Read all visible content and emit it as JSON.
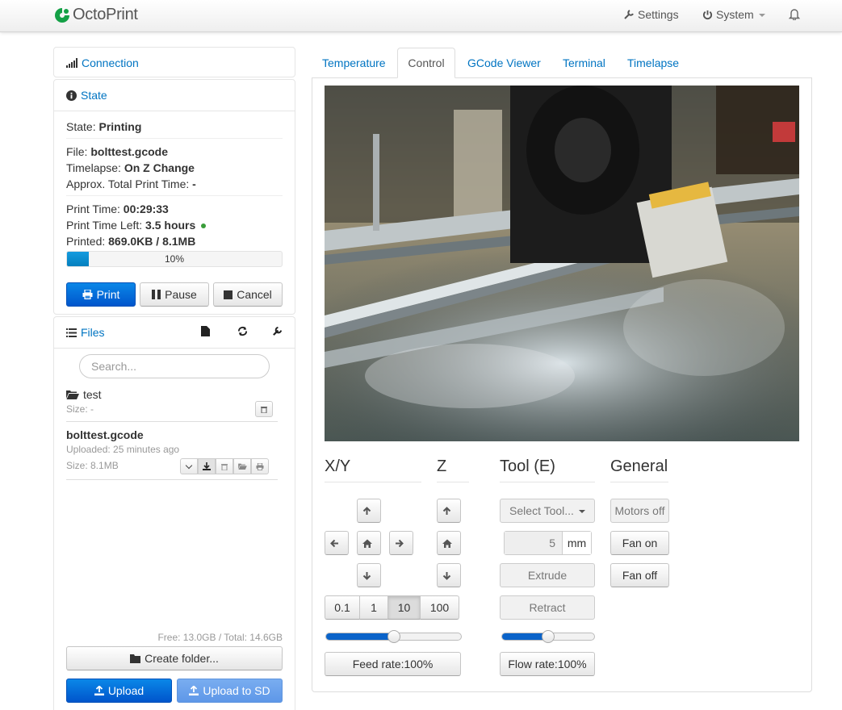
{
  "app": {
    "brand": "OctoPrint"
  },
  "navbar": {
    "settings": "Settings",
    "system": "System"
  },
  "sidebar": {
    "connection": {
      "title": "Connection"
    },
    "state": {
      "title": "State",
      "state_label": "State:",
      "state_value": "Printing",
      "file_label": "File:",
      "file_value": "bolttest.gcode",
      "timelapse_label": "Timelapse:",
      "timelapse_value": "On Z Change",
      "approx_label": "Approx. Total Print Time:",
      "approx_value": "-",
      "print_time_label": "Print Time:",
      "print_time_value": "00:29:33",
      "time_left_label": "Print Time Left:",
      "time_left_value": "3.5 hours",
      "printed_label": "Printed:",
      "printed_value": "869.0KB / 8.1MB",
      "progress": 10,
      "progress_text": "10%",
      "buttons": {
        "print": "Print",
        "pause": "Pause",
        "cancel": "Cancel"
      }
    },
    "files": {
      "title": "Files",
      "search_placeholder": "Search...",
      "items": [
        {
          "name": "test",
          "meta": "Size: -"
        },
        {
          "name": "bolttest.gcode",
          "uploaded": "Uploaded: 25 minutes ago",
          "size": "Size: 8.1MB"
        }
      ],
      "free_total": "Free: 13.0GB / Total: 14.6GB",
      "create_folder": "Create folder...",
      "upload": "Upload",
      "upload_sd": "Upload to SD"
    }
  },
  "tabs": [
    "Temperature",
    "Control",
    "GCode Viewer",
    "Terminal",
    "Timelapse"
  ],
  "active_tab": "Control",
  "control": {
    "xy_title": "X/Y",
    "z_title": "Z",
    "tool_title": "Tool (E)",
    "general_title": "General",
    "step_sizes": [
      "0.1",
      "1",
      "10",
      "100"
    ],
    "active_step": "10",
    "feed_rate": "Feed rate:100%",
    "feed_rate_level": 50,
    "flow_rate": "Flow rate:100%",
    "flow_rate_level": 50,
    "select_tool": "Select Tool...",
    "extrude_amount": "5",
    "extrude_unit": "mm",
    "extrude": "Extrude",
    "retract": "Retract",
    "motors_off": "Motors off",
    "fan_on": "Fan on",
    "fan_off": "Fan off"
  },
  "colors": {
    "accent": "#0074c2",
    "primary_button": "#0a6fd9",
    "status_dot": "#3a9d3a"
  }
}
